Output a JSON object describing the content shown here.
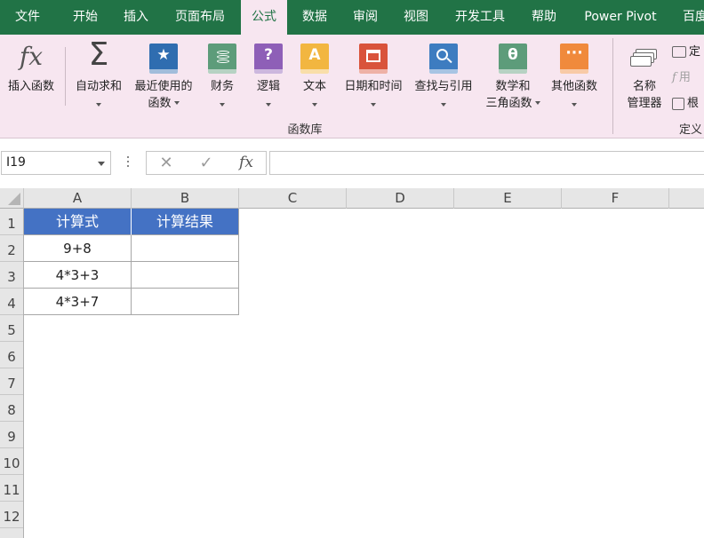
{
  "menu_tabs": [
    {
      "label": "文件"
    },
    {
      "label": "开始"
    },
    {
      "label": "插入"
    },
    {
      "label": "页面布局"
    },
    {
      "label": "公式",
      "active": true
    },
    {
      "label": "数据"
    },
    {
      "label": "审阅"
    },
    {
      "label": "视图"
    },
    {
      "label": "开发工具"
    },
    {
      "label": "帮助"
    },
    {
      "label": "Power Pivot"
    },
    {
      "label": "百度"
    }
  ],
  "ribbon": {
    "insert_function": {
      "icon_text": "fx",
      "label": "插入函数"
    },
    "autosum": {
      "icon_text": "Σ",
      "label": "自动求和"
    },
    "recent": {
      "icon_text": "★",
      "label_line1": "最近使用的",
      "label_line2": "函数"
    },
    "financial": {
      "label": "财务"
    },
    "logical": {
      "icon_text": "?",
      "label": "逻辑"
    },
    "text": {
      "icon_text": "A",
      "label": "文本"
    },
    "datetime": {
      "label": "日期和时间"
    },
    "lookup": {
      "label": "查找与引用"
    },
    "math": {
      "icon_text": "θ",
      "label_line1": "数学和",
      "label_line2": "三角函数"
    },
    "more": {
      "icon_text": "···",
      "label": "其他函数"
    },
    "group_label": "函数库",
    "name_manager": {
      "label_line1": "名称",
      "label_line2": "管理器"
    },
    "define_name_label": "定",
    "use_in_formula_label": "用",
    "create_from_selection_label": "根",
    "group2_label": "定义"
  },
  "formula_bar": {
    "name_box": "I19",
    "cancel_icon": "✕",
    "enter_icon": "✓",
    "fx_icon": "fx",
    "formula": ""
  },
  "grid": {
    "columns": [
      "A",
      "B",
      "C",
      "D",
      "E",
      "F"
    ],
    "rows": [
      "1",
      "2",
      "3",
      "4",
      "5",
      "6",
      "7",
      "8",
      "9",
      "10",
      "11",
      "12"
    ],
    "header_row": [
      "计算式",
      "计算结果"
    ],
    "data_rows": [
      [
        "9+8",
        ""
      ],
      [
        "4*3+3",
        ""
      ],
      [
        "4*3+7",
        ""
      ]
    ],
    "header_fill": "#4472c4"
  },
  "colors": {
    "title_bar": "#217346",
    "ribbon_bg": "#f7e6f0"
  }
}
